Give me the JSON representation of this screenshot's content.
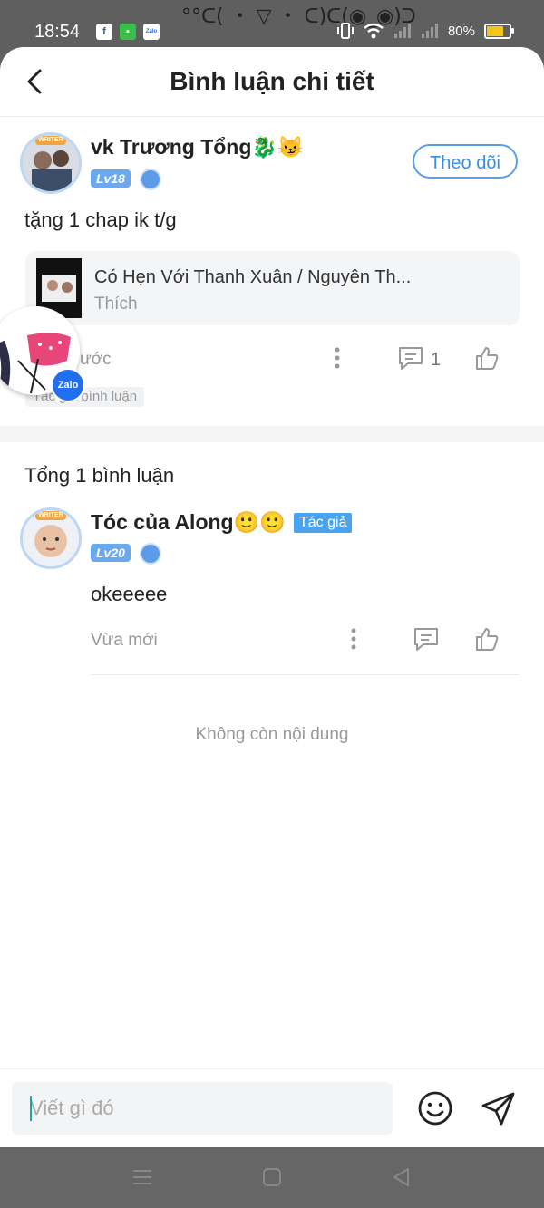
{
  "status_bar": {
    "time": "18:54",
    "kaomoji": "°°ᑕ( ・ ▽ ・ ᑕ)ᑕ(◉_◉)ᑐ",
    "battery": "80%",
    "battery_level": 0.8,
    "left_icons": [
      "facebook-icon",
      "wechat-icon",
      "zalo-icon"
    ]
  },
  "header": {
    "title": "Bình luận chi tiết"
  },
  "main_comment": {
    "username": "vk Trương Tổng🐉😼",
    "level": "Lv18",
    "follow_label": "Theo dõi",
    "text": "tặng 1 chap ik t/g",
    "book": {
      "title": "Có Hẹn Với Thanh Xuân / Nguyên Th...",
      "subtitle": "Thích"
    },
    "time": "ước",
    "reply_count": "1",
    "author_tag": "Tác giả bình luận"
  },
  "replies_section": {
    "total_label": "Tổng 1 bình luận",
    "replies": [
      {
        "username": "Tóc của Along🙂🙂",
        "author_badge": "Tác giả",
        "level": "Lv20",
        "text": "okeeeee",
        "time": "Vừa mới"
      }
    ],
    "end_label": "Không còn nội dung"
  },
  "composer": {
    "placeholder": "Viết gì đó"
  },
  "floating": {
    "zalo_label": "Zalo"
  },
  "colors": {
    "accent": "#3b8ee4",
    "author_badge": "#4aa3ee",
    "level_badge": "#6aa8f0"
  }
}
